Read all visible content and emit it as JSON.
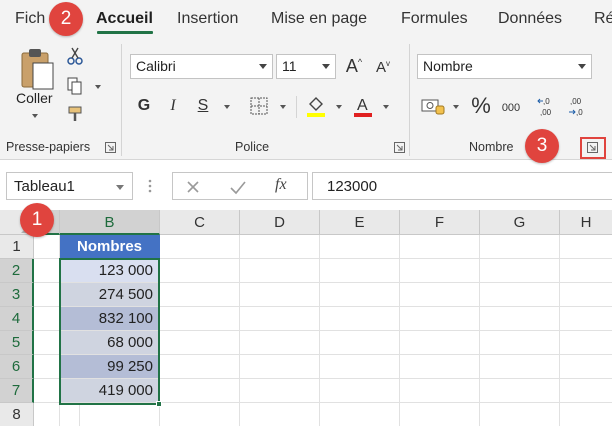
{
  "tabs": [
    {
      "label": "Fich",
      "active": false
    },
    {
      "label": "Accueil",
      "active": true
    },
    {
      "label": "Insertion",
      "active": false
    },
    {
      "label": "Mise en page",
      "active": false
    },
    {
      "label": "Formules",
      "active": false
    },
    {
      "label": "Données",
      "active": false
    },
    {
      "label": "Ré",
      "active": false
    }
  ],
  "ribbon": {
    "clipboard": {
      "paste_label": "Coller",
      "group_label": "Presse-papiers"
    },
    "font": {
      "font_name": "Calibri",
      "font_size": "11",
      "bold": "G",
      "italic": "I",
      "underline": "S",
      "group_label": "Police"
    },
    "number": {
      "format": "Nombre",
      "percent": "%",
      "thousands": "000",
      "group_label": "Nombre"
    }
  },
  "formula_bar": {
    "name_box": "Tableau1",
    "fx": "fx",
    "value": "123000"
  },
  "grid": {
    "columns": [
      "B",
      "C",
      "D",
      "E",
      "F",
      "G",
      "H"
    ],
    "rows": [
      "1",
      "2",
      "3",
      "4",
      "5",
      "6",
      "7",
      "8"
    ],
    "table_header": "Nombres",
    "values": [
      "123 000",
      "274 500",
      "832 100",
      "68 000",
      "99 250",
      "419 000"
    ]
  },
  "callouts": [
    "1",
    "2",
    "3"
  ],
  "colors": {
    "accent": "#217346",
    "table_header": "#4472c4",
    "callout": "#e0443e"
  }
}
